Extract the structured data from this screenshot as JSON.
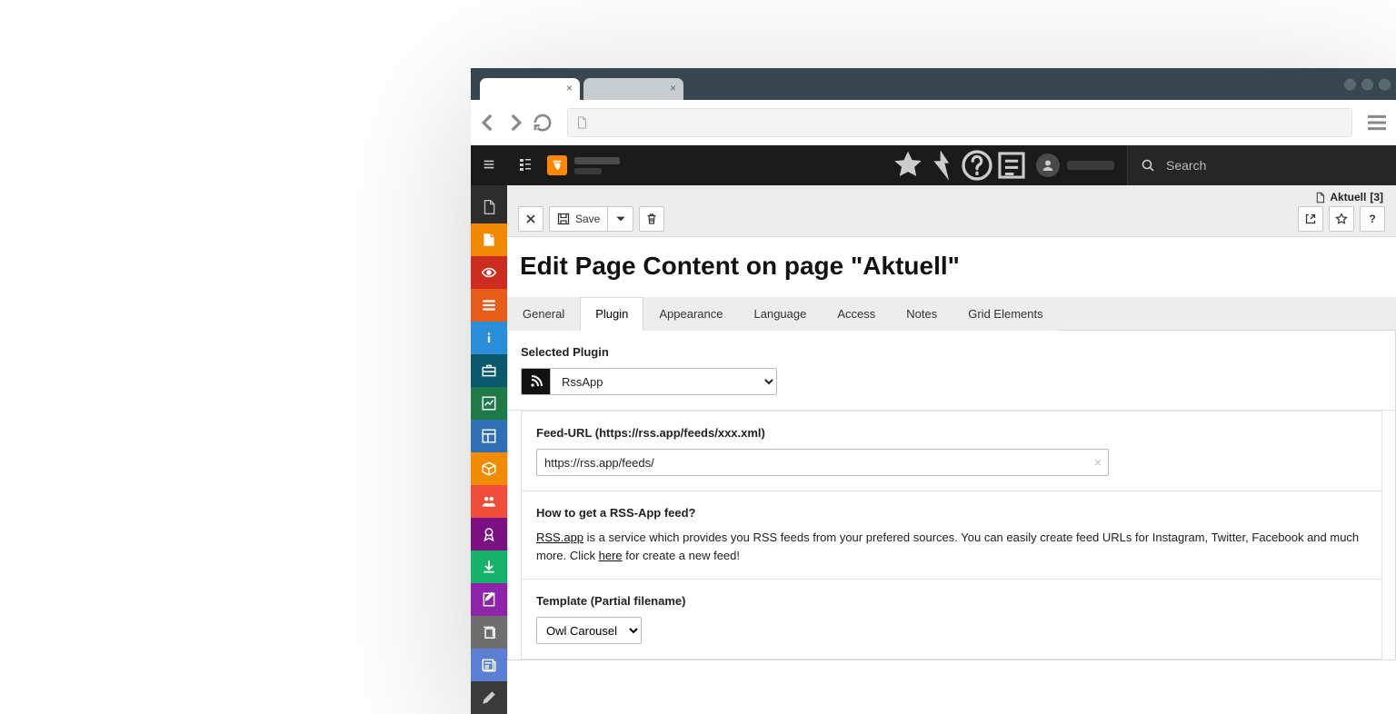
{
  "header": {
    "search_placeholder": "Search"
  },
  "pathbar": {
    "label": "Aktuell",
    "count": "[3]"
  },
  "toolbar": {
    "save_label": "Save"
  },
  "page": {
    "title": "Edit Page Content on page \"Aktuell\""
  },
  "tabs": [
    {
      "label": "General"
    },
    {
      "label": "Plugin"
    },
    {
      "label": "Appearance"
    },
    {
      "label": "Language"
    },
    {
      "label": "Access"
    },
    {
      "label": "Notes"
    },
    {
      "label": "Grid Elements"
    }
  ],
  "plugin": {
    "selected_label": "Selected Plugin",
    "selected_value": "RssApp",
    "feed_label": "Feed-URL (https://rss.app/feeds/xxx.xml)",
    "feed_value": "https://rss.app/feeds/",
    "help_heading": "How to get a RSS-App feed?",
    "help_link1": "RSS.app",
    "help_before": " is a service which provides you RSS feeds from your prefered sources. You can easily create feed URLs for Instagram, Twitter, Facebook and much more. Click ",
    "help_link2": "here",
    "help_after": " for create a new feed!",
    "template_label": "Template (Partial filename)",
    "template_value": "Owl Carousel"
  },
  "side_modules": [
    {
      "name": "page",
      "bg": "transparent",
      "fg": "#bbbbbb",
      "icon": "file"
    },
    {
      "name": "page-mod",
      "bg": "#f18900",
      "fg": "#ffffff",
      "icon": "doc"
    },
    {
      "name": "view",
      "bg": "#cc2b1f",
      "fg": "#ffffff",
      "icon": "eye"
    },
    {
      "name": "list",
      "bg": "#e85c19",
      "fg": "#ffffff",
      "icon": "lines"
    },
    {
      "name": "info",
      "bg": "#2a8ed9",
      "fg": "#ffffff",
      "icon": "info"
    },
    {
      "name": "workspaces",
      "bg": "#0a5a6d",
      "fg": "#ffffff",
      "icon": "briefcase"
    },
    {
      "name": "dashboard",
      "bg": "#1f7a4a",
      "fg": "#ffffff",
      "icon": "chart"
    },
    {
      "name": "layout",
      "bg": "#2f6fb3",
      "fg": "#ffffff",
      "icon": "layout"
    },
    {
      "name": "ext",
      "bg": "#f38b00",
      "fg": "#ffffff",
      "icon": "box"
    },
    {
      "name": "users",
      "bg": "#f04e3a",
      "fg": "#ffffff",
      "icon": "users"
    },
    {
      "name": "award",
      "bg": "#7a1081",
      "fg": "#ffffff",
      "icon": "badge"
    },
    {
      "name": "install",
      "bg": "#17b26a",
      "fg": "#ffffff",
      "icon": "down"
    },
    {
      "name": "forms",
      "bg": "#8e24aa",
      "fg": "#ffffff",
      "icon": "form"
    },
    {
      "name": "templates",
      "bg": "#6e6e6e",
      "fg": "#ffffff",
      "icon": "stack"
    },
    {
      "name": "news",
      "bg": "#5c7fd6",
      "fg": "#ffffff",
      "icon": "news"
    },
    {
      "name": "tool",
      "bg": "#3a3a3a",
      "fg": "#cccccc",
      "icon": "pen"
    }
  ]
}
